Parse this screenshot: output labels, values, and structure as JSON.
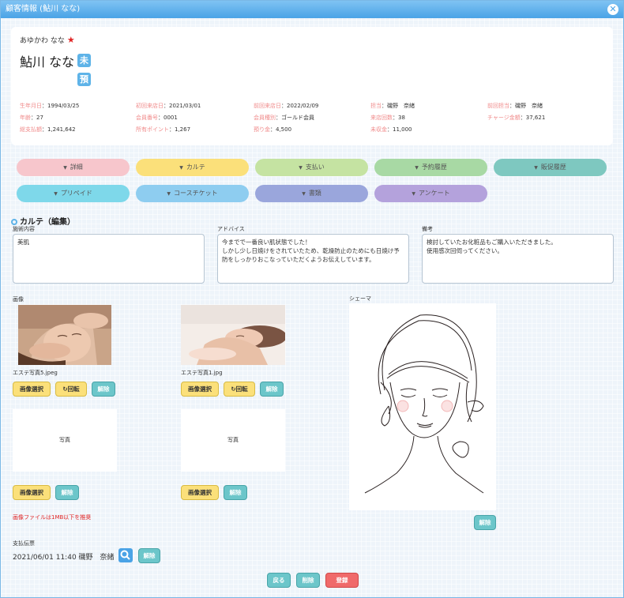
{
  "window": {
    "title": "顧客情報 (鮎川 なな)",
    "close_symbol": "✕"
  },
  "customer": {
    "kana": "あゆかわ なな",
    "star": "★",
    "name": "鮎川 なな",
    "badge1": "未",
    "badge2": "預"
  },
  "info": [
    {
      "key": "生年月日",
      "value": "：1994/03/25"
    },
    {
      "key": "初回来店日",
      "value": "：2021/03/01"
    },
    {
      "key": "前回来店日",
      "value": "：2022/02/09"
    },
    {
      "key": "担当",
      "value": "：磯野　奈緒"
    },
    {
      "key": "前回担当",
      "value": "：磯野　奈緒"
    },
    {
      "key": "年齢",
      "value": "：27"
    },
    {
      "key": "会員番号",
      "value": "：0001"
    },
    {
      "key": "会員種別",
      "value": "：ゴールド会員"
    },
    {
      "key": "来店回数",
      "value": "：38"
    },
    {
      "key": "チャージ金額",
      "value": "：37,621"
    },
    {
      "key": "総支払額",
      "value": "：1,241,642"
    },
    {
      "key": "所有ポイント",
      "value": "：1,267"
    },
    {
      "key": "預り金",
      "value": "：4,500"
    },
    {
      "key": "未収金",
      "value": "：11,000"
    }
  ],
  "tabs": [
    {
      "label": "詳細",
      "color": "#f7c6cc"
    },
    {
      "label": "カルテ",
      "color": "#fbe07a"
    },
    {
      "label": "支払い",
      "color": "#c5e3a2"
    },
    {
      "label": "予約履歴",
      "color": "#a8d9a4"
    },
    {
      "label": "販促履歴",
      "color": "#7ec8c0"
    },
    {
      "label": "プリペイド",
      "color": "#7ed8ea"
    },
    {
      "label": "コースチケット",
      "color": "#8ecdf0"
    },
    {
      "label": "書類",
      "color": "#9aa6dc"
    },
    {
      "label": "アンケート",
      "color": "#b4a2dc"
    }
  ],
  "karte": {
    "title": "カルテ（編集）",
    "treatment_label": "施術内容",
    "treatment_value": "美肌",
    "advice_label": "アドバイス",
    "advice_value": "今までで一番良い肌状態でした！\nしかし少し日焼けをされていたため、乾燥防止のためにも日焼け予防をしっかりおこなっていただくようお伝えしています。",
    "notes_label": "備考",
    "notes_value": "検討していたお化粧品もご購入いただきました。\n使用感次回伺ってください。"
  },
  "images": {
    "label": "画像",
    "file1": "エステ写真5.jpeg",
    "file2": "エステ写真1.jpg",
    "select": "画像選択",
    "rotate": "回転",
    "rotate_icon": "↻",
    "clear": "解除",
    "photo_placeholder": "写真",
    "warning": "画像ファイルは1MB以下を推奨"
  },
  "schema": {
    "label": "シェーマ",
    "clear": "解除"
  },
  "payment": {
    "label": "支払伝票",
    "value": "2021/06/01 11:40 磯野　奈緒",
    "clear": "解除"
  },
  "footer": {
    "back": "戻る",
    "delete": "削除",
    "register": "登録"
  }
}
